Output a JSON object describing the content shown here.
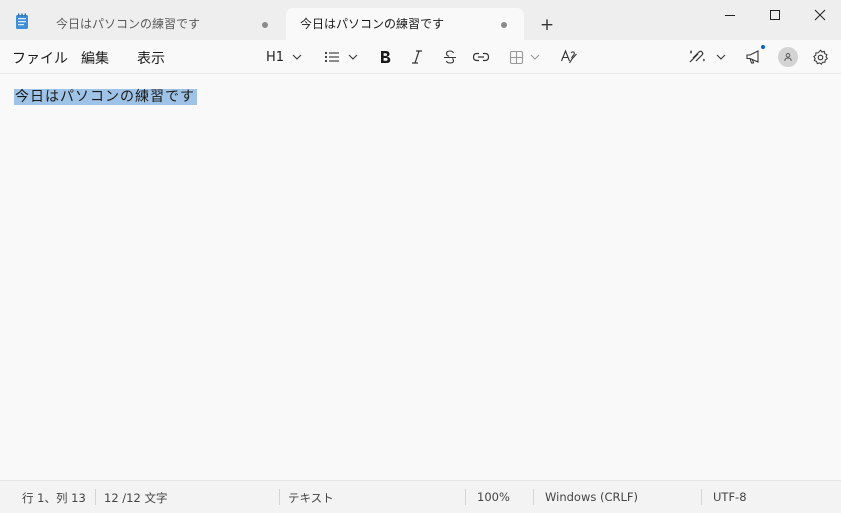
{
  "window": {
    "app_icon": "notepad-icon",
    "tabs": [
      {
        "title": "今日はパソコンの練習です",
        "active": false,
        "unsaved": true
      },
      {
        "title": "今日はパソコンの練習です",
        "active": true,
        "unsaved": true
      }
    ],
    "new_tab_label": "+",
    "controls": [
      "minimize-icon",
      "maximize-icon",
      "close-icon"
    ]
  },
  "menu": {
    "file": "ファイル",
    "edit": "編集",
    "view": "表示"
  },
  "toolbar": {
    "heading": "H1",
    "icons": [
      "list-icon",
      "bold-icon",
      "italic-icon",
      "strikethrough-icon",
      "link-icon",
      "table-icon",
      "spellcheck-icon",
      "copilot-icon",
      "announcement-icon",
      "account-icon",
      "settings-icon"
    ]
  },
  "editor": {
    "text": "今日はパソコンの練習です",
    "selection": "all"
  },
  "status": {
    "position": "行 1、列 13",
    "char_count": "12 /12 文字",
    "mode": "テキスト",
    "zoom": "100%",
    "line_ending": "Windows (CRLF)",
    "encoding": "UTF-8"
  },
  "colors": {
    "selection": "#9ec3e6",
    "accent": "#0067c0",
    "titlebar": "#eeeeee",
    "editor_bg": "#f9f9f9"
  }
}
